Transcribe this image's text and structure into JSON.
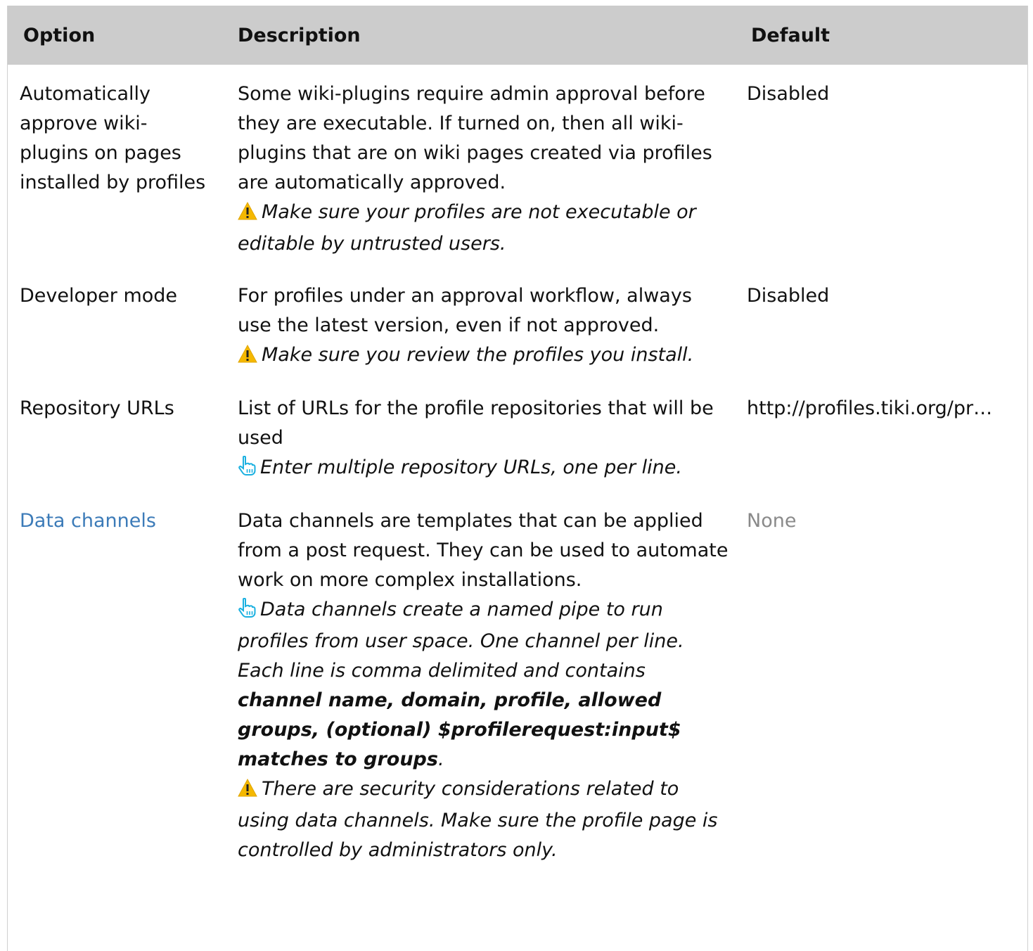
{
  "headers": {
    "option": "Option",
    "description": "Description",
    "default": "Default"
  },
  "rows": [
    {
      "option": "Automatically approve wiki-plugins on pages installed by profiles",
      "description": "Some wiki-plugins require admin approval before they are executable. If turned on, then all wiki-plugins that are on wiki pages created via profiles are automatically approved.",
      "note_icon": "warning-icon",
      "note": "Make sure your profiles are not executable or editable by untrusted users.",
      "default": "Disabled"
    },
    {
      "option": "Developer mode",
      "description": "For profiles under an approval workflow, always use the latest version, even if not approved.",
      "note_icon": "warning-icon",
      "note": "Make sure you review the profiles you install.",
      "default": "Disabled"
    },
    {
      "option": "Repository URLs",
      "description": "List of URLs for the profile repositories that will be used",
      "note_icon": "pointing-hand-icon",
      "note": "Enter multiple repository URLs, one per line.",
      "default": "http://profiles.tiki.org/pr…"
    },
    {
      "option": "Data channels",
      "description": "Data channels are templates that can be applied from a post request. They can be used to automate work on more complex installations.",
      "note_icon": "pointing-hand-icon",
      "note": "Data channels create a named pipe to run profiles from user space. One channel per line. Each line is comma delimited and contains",
      "note_bold": "channel name, domain, profile, allowed groups, (optional) $profilerequest:input$ matches to groups",
      "note_tail": ".",
      "note2_icon": "warning-icon",
      "note2": "There are security considerations related to using data channels. Make sure the profile page is controlled by administrators only.",
      "default": "None"
    }
  ],
  "colors": {
    "header_bg": "#cccccc",
    "link": "#3c7bb8",
    "muted": "#8a8a8a",
    "warning": "#f5b800",
    "hand": "#1ab0e0"
  }
}
